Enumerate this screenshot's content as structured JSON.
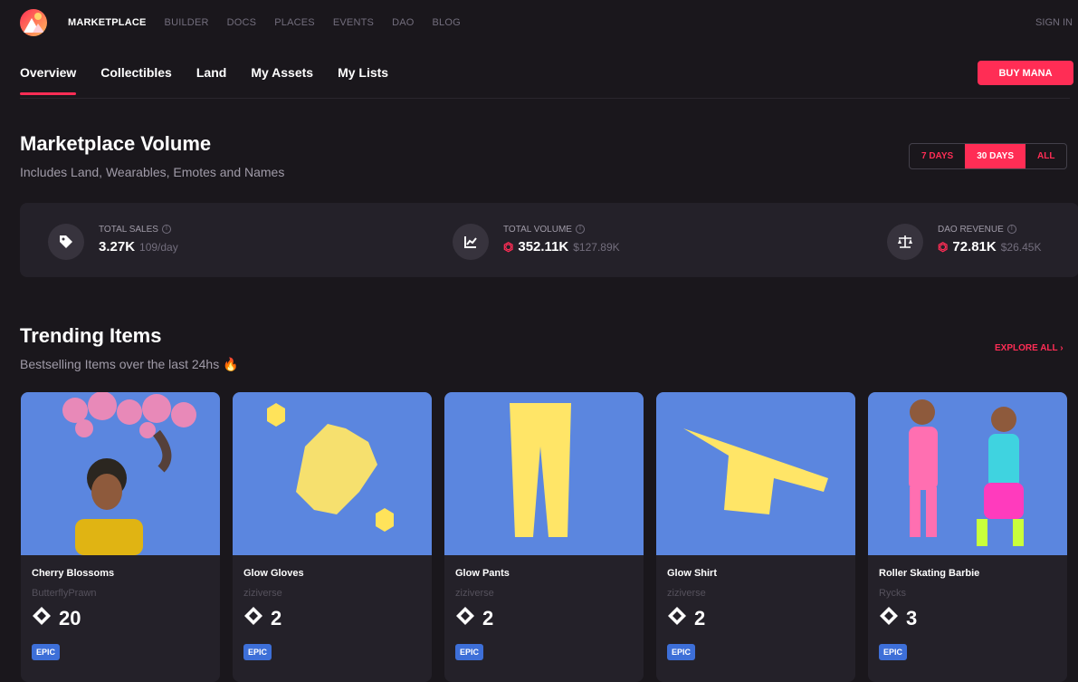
{
  "topnav": {
    "items": [
      "MARKETPLACE",
      "BUILDER",
      "DOCS",
      "PLACES",
      "EVENTS",
      "DAO",
      "BLOG"
    ],
    "signin": "SIGN IN"
  },
  "tabs": [
    "Overview",
    "Collectibles",
    "Land",
    "My Assets",
    "My Lists"
  ],
  "buy_mana": "BUY MANA",
  "volume": {
    "title": "Marketplace Volume",
    "subtitle": "Includes Land, Wearables, Emotes and Names",
    "ranges": [
      "7 DAYS",
      "30 DAYS",
      "ALL"
    ],
    "selected_range": "30 DAYS",
    "stats": [
      {
        "label": "TOTAL SALES",
        "value": "3.27K",
        "secondary": "109/day"
      },
      {
        "label": "TOTAL VOLUME",
        "value": "352.11K",
        "secondary": "$127.89K"
      },
      {
        "label": "DAO REVENUE",
        "value": "72.81K",
        "secondary": "$26.45K"
      }
    ]
  },
  "trending": {
    "title": "Trending Items",
    "subtitle": "Bestselling Items over the last 24hs",
    "explore": "EXPLORE ALL",
    "items": [
      {
        "name": "Cherry Blossoms",
        "creator": "ButterflyPrawn",
        "price": "20",
        "rarity": "EPIC"
      },
      {
        "name": "Glow Gloves",
        "creator": "ziziverse",
        "price": "2",
        "rarity": "EPIC"
      },
      {
        "name": "Glow Pants",
        "creator": "ziziverse",
        "price": "2",
        "rarity": "EPIC"
      },
      {
        "name": "Glow Shirt",
        "creator": "ziziverse",
        "price": "2",
        "rarity": "EPIC"
      },
      {
        "name": "Roller Skating Barbie",
        "creator": "Rycks",
        "price": "3",
        "rarity": "EPIC"
      }
    ]
  },
  "colors": {
    "accent": "#ff2d55",
    "epic": "#3d6fd8",
    "card_bg": "#242129"
  }
}
